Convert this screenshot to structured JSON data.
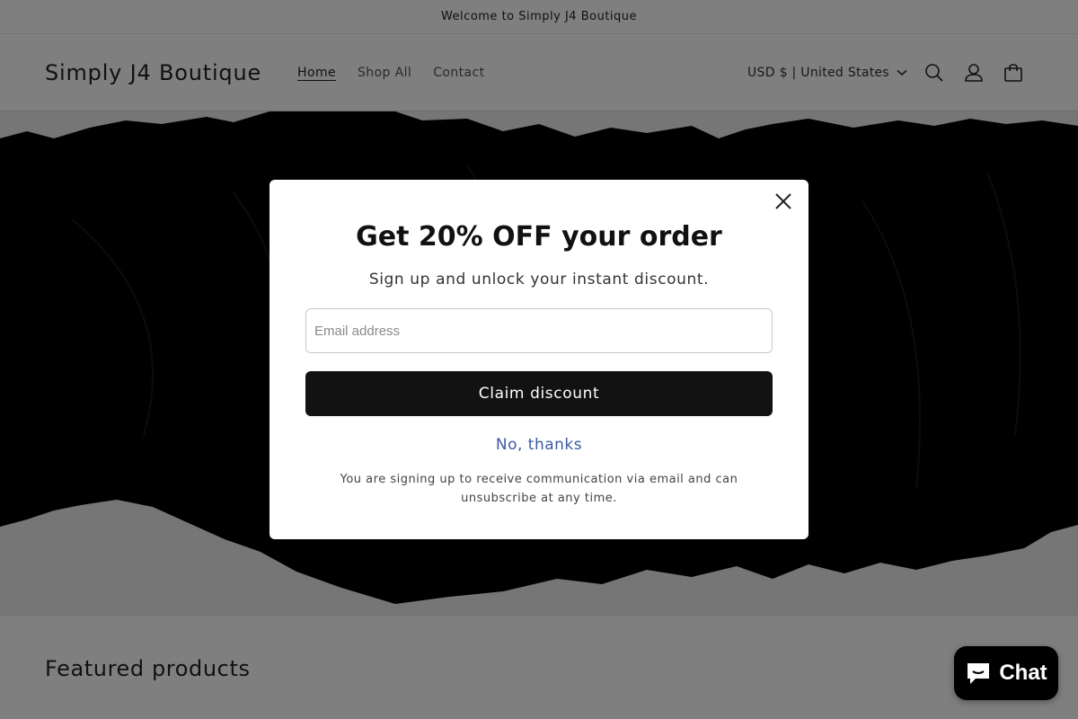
{
  "announcement": {
    "text": "Welcome to Simply J4 Boutique"
  },
  "header": {
    "logo": "Simply J4 Boutique",
    "nav": [
      {
        "label": "Home",
        "active": true
      },
      {
        "label": "Shop All",
        "active": false
      },
      {
        "label": "Contact",
        "active": false
      }
    ],
    "currency": "USD $ | United States",
    "icons": [
      "search-icon",
      "account-icon",
      "cart-icon"
    ]
  },
  "featured": {
    "heading": "Featured products"
  },
  "popup": {
    "title": "Get 20% OFF your order",
    "subtitle": "Sign up and unlock your instant discount.",
    "email_placeholder": "Email address",
    "email_value": "",
    "claim_label": "Claim discount",
    "decline_label": "No, thanks",
    "disclaimer": "You are signing up to receive communication via email and can unsubscribe at any time."
  },
  "chat": {
    "label": "Chat"
  },
  "colors": {
    "accent_link": "#3b5ba5",
    "button_bg": "#121212",
    "overlay": "rgba(0,0,0,0.5)"
  }
}
